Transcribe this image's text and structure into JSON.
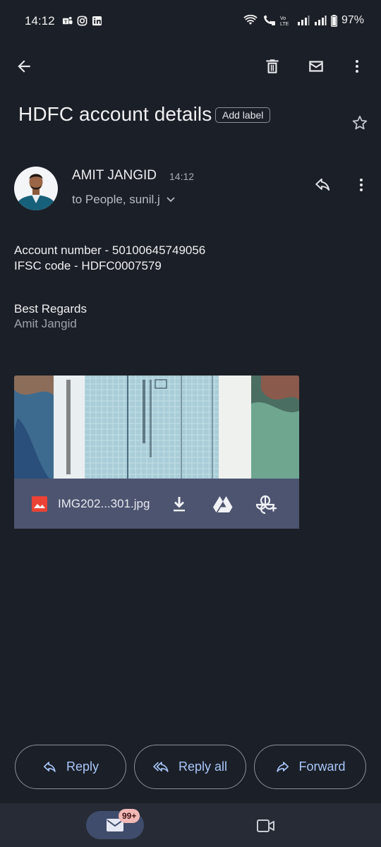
{
  "status_bar": {
    "time": "14:12",
    "battery": "97%",
    "left_icons": [
      "teams-icon",
      "instagram-icon",
      "linkedin-icon"
    ],
    "right_icons": [
      "wifi-icon",
      "wifi-call-icon",
      "volte-icon",
      "signal-icon",
      "signal-icon",
      "battery-icon"
    ]
  },
  "toolbar": {
    "back_icon": "arrow-back-icon",
    "actions": [
      "delete-icon",
      "mark-unread-icon",
      "more-vert-icon"
    ]
  },
  "email": {
    "subject": "HDFC account details",
    "add_label": "Add label",
    "sender": {
      "name": "AMIT JANGID",
      "time": "14:12",
      "recipients": "to People, sunil.j"
    },
    "body": {
      "line1": "Account number - 50100645749056",
      "line2": "IFSC code - HDFC0007579",
      "regards": "Best Regards",
      "signature": "Amit Jangid"
    },
    "attachment": {
      "filename": "IMG202...301.jpg",
      "actions": [
        "download-icon",
        "drive-icon",
        "photos-add-icon"
      ]
    }
  },
  "actions": {
    "reply": "Reply",
    "reply_all": "Reply all",
    "forward": "Forward"
  },
  "nav": {
    "mail_badge": "99+",
    "items": [
      "mail-icon",
      "meet-icon"
    ]
  },
  "colors": {
    "background": "#1b1f27",
    "accent": "#a8c7fa",
    "attachment_bar": "#4d5470",
    "badge": "#f2b8b5"
  }
}
